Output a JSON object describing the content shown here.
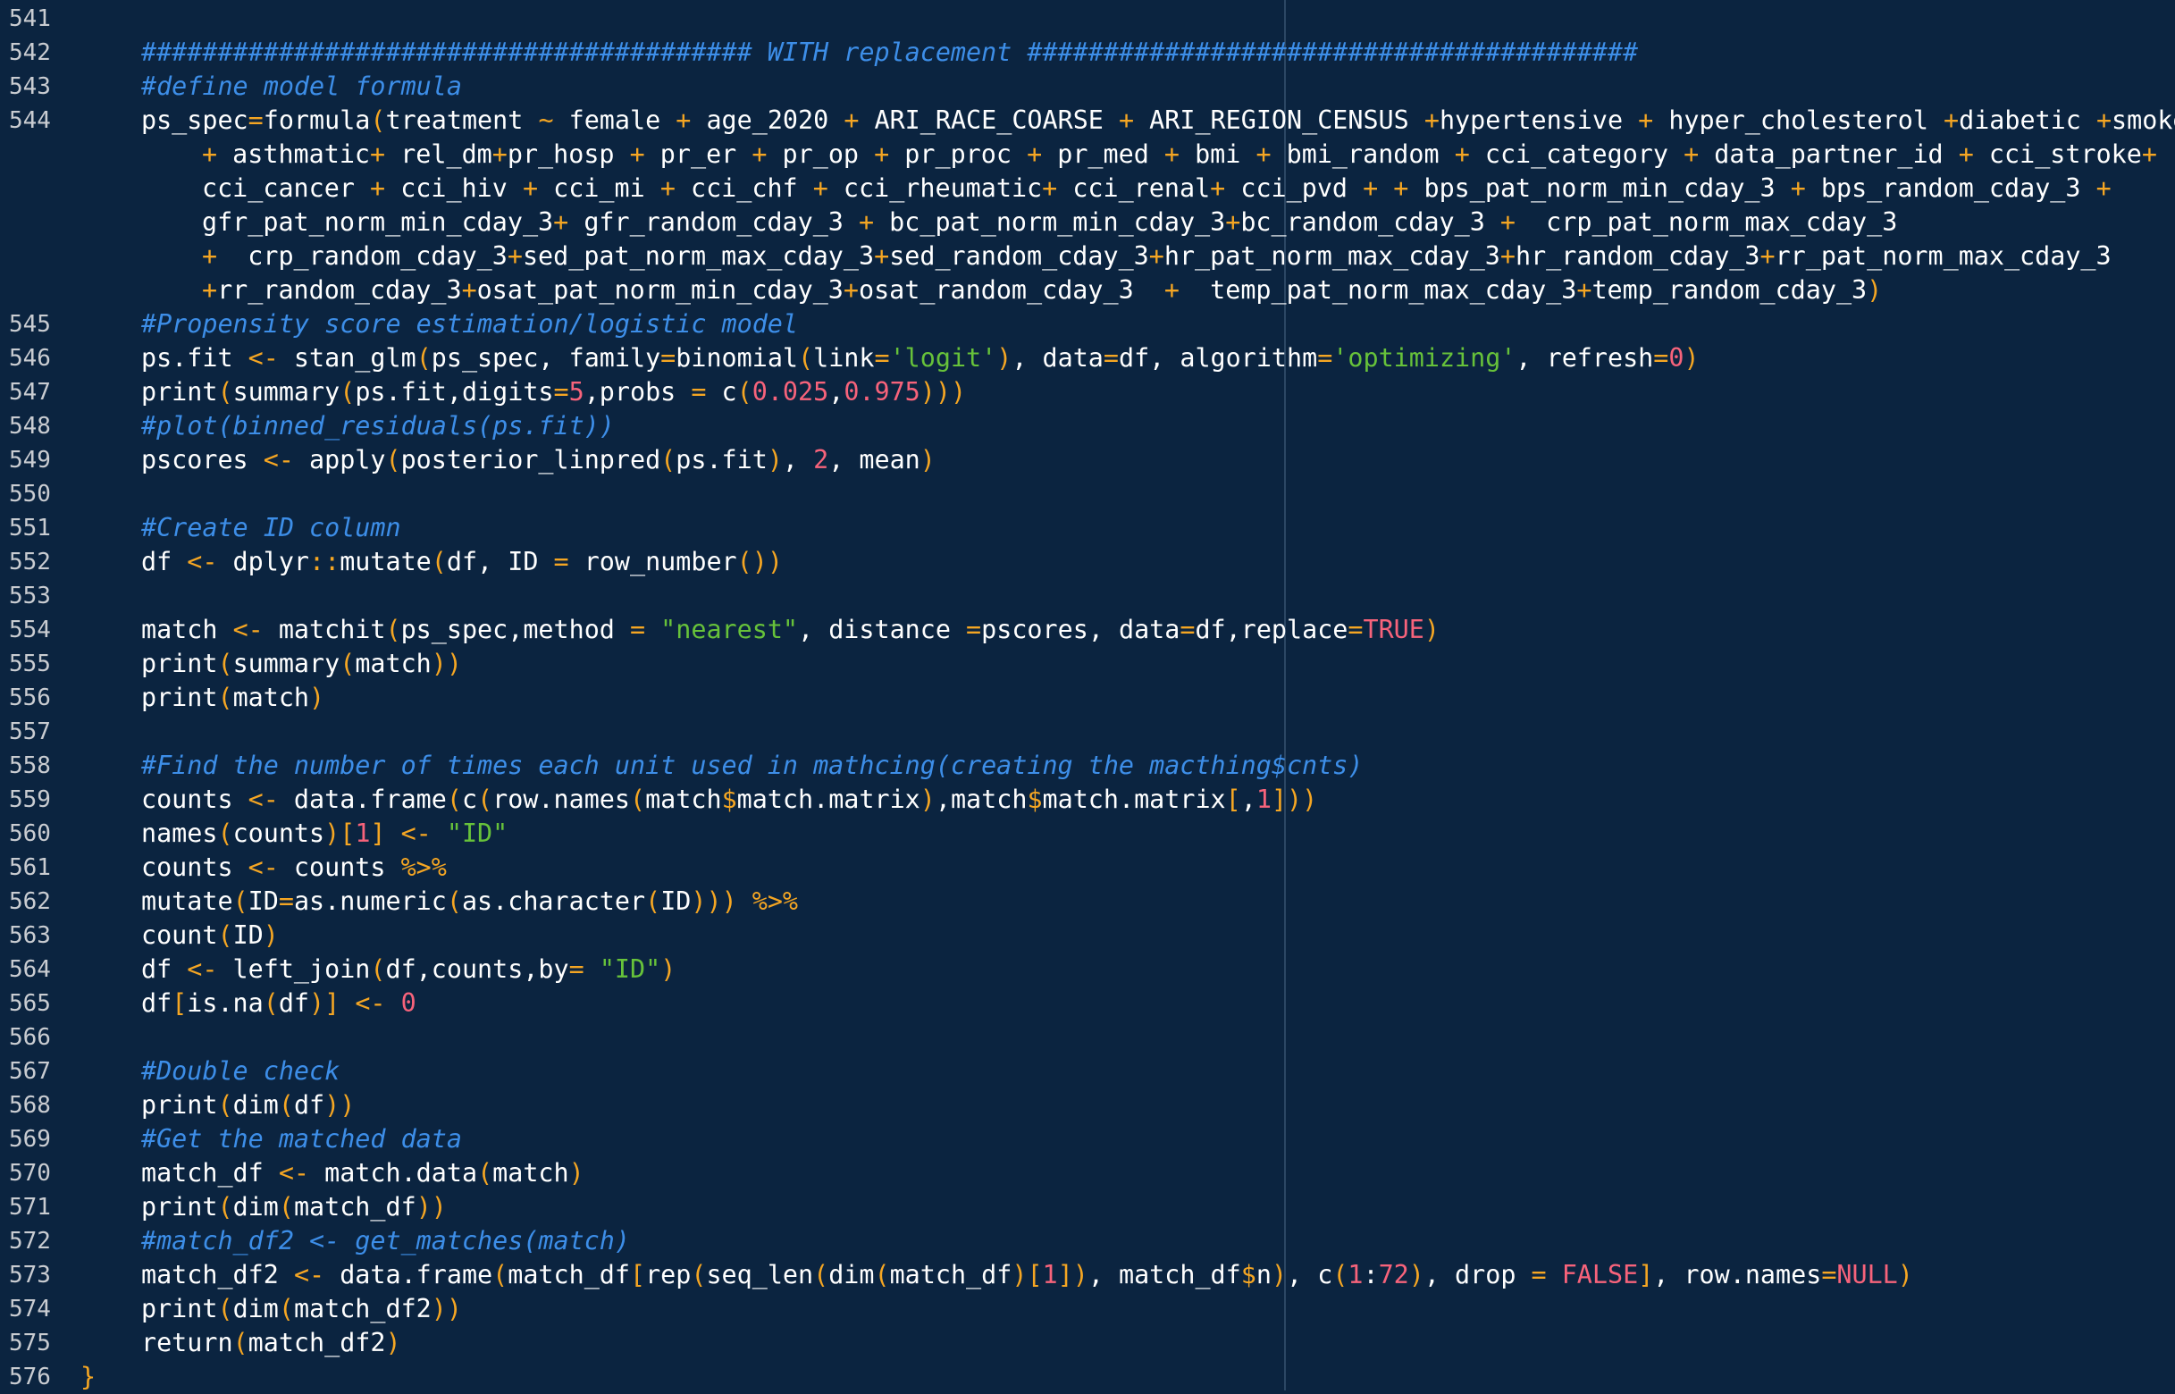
{
  "editor": {
    "lines": [
      {
        "n": "541",
        "t": ""
      },
      {
        "n": "542",
        "t": "######################################## WITH replacement ########################################"
      },
      {
        "n": "543",
        "t": "#define model formula"
      },
      {
        "n": "544",
        "t": "ps_spec=formula(treatment ~ female + age_2020 + ARI_RACE_COARSE + ARI_REGION_CENSUS +hypertensive + hyper_cholesterol +diabetic +smoker"
      },
      {
        "n": "",
        "t": "+ asthmatic+ rel_dm+pr_hosp + pr_er + pr_op + pr_proc + pr_med + bmi + bmi_random + cci_category + data_partner_id + cci_stroke+"
      },
      {
        "n": "",
        "t": "cci_cancer + cci_hiv + cci_mi + cci_chf + cci_rheumatic+ cci_renal+ cci_pvd + + bps_pat_norm_min_cday_3 + bps_random_cday_3 +"
      },
      {
        "n": "",
        "t": "gfr_pat_norm_min_cday_3+ gfr_random_cday_3 + bc_pat_norm_min_cday_3+bc_random_cday_3 +  crp_pat_norm_max_cday_3"
      },
      {
        "n": "",
        "t": "+  crp_random_cday_3+sed_pat_norm_max_cday_3+sed_random_cday_3+hr_pat_norm_max_cday_3+hr_random_cday_3+rr_pat_norm_max_cday_3"
      },
      {
        "n": "",
        "t": "+rr_random_cday_3+osat_pat_norm_min_cday_3+osat_random_cday_3  +  temp_pat_norm_max_cday_3+temp_random_cday_3)"
      },
      {
        "n": "545",
        "t": "#Propensity score estimation/logistic model"
      },
      {
        "n": "546",
        "t": "ps.fit <- stan_glm(ps_spec, family=binomial(link='logit'), data=df, algorithm='optimizing', refresh=0)"
      },
      {
        "n": "547",
        "t": "print(summary(ps.fit,digits=5,probs = c(0.025,0.975)))"
      },
      {
        "n": "548",
        "t": "#plot(binned_residuals(ps.fit))"
      },
      {
        "n": "549",
        "t": "pscores <- apply(posterior_linpred(ps.fit), 2, mean)"
      },
      {
        "n": "550",
        "t": ""
      },
      {
        "n": "551",
        "t": "#Create ID column"
      },
      {
        "n": "552",
        "t": "df <- dplyr::mutate(df, ID = row_number())"
      },
      {
        "n": "553",
        "t": ""
      },
      {
        "n": "554",
        "t": "match <- matchit(ps_spec,method = \"nearest\", distance =pscores, data=df,replace=TRUE)"
      },
      {
        "n": "555",
        "t": "print(summary(match))"
      },
      {
        "n": "556",
        "t": "print(match)"
      },
      {
        "n": "557",
        "t": ""
      },
      {
        "n": "558",
        "t": "#Find the number of times each unit used in mathcing(creating the macthing$cnts)"
      },
      {
        "n": "559",
        "t": "counts <- data.frame(c(row.names(match$match.matrix),match$match.matrix[,1]))"
      },
      {
        "n": "560",
        "t": "names(counts)[1] <- \"ID\""
      },
      {
        "n": "561",
        "t": "counts <- counts %>%"
      },
      {
        "n": "562",
        "t": "mutate(ID=as.numeric(as.character(ID))) %>%"
      },
      {
        "n": "563",
        "t": "count(ID)"
      },
      {
        "n": "564",
        "t": "df <- left_join(df,counts,by= \"ID\")"
      },
      {
        "n": "565",
        "t": "df[is.na(df)] <- 0"
      },
      {
        "n": "566",
        "t": ""
      },
      {
        "n": "567",
        "t": "#Double check"
      },
      {
        "n": "568",
        "t": "print(dim(df))"
      },
      {
        "n": "569",
        "t": "#Get the matched data"
      },
      {
        "n": "570",
        "t": "match_df <- match.data(match)"
      },
      {
        "n": "571",
        "t": "print(dim(match_df))"
      },
      {
        "n": "572",
        "t": "#match_df2 <- get_matches(match)"
      },
      {
        "n": "573",
        "t": "match_df2 <- data.frame(match_df[rep(seq_len(dim(match_df)[1]), match_df$n), c(1:72), drop = FALSE], row.names=NULL)"
      },
      {
        "n": "574",
        "t": "print(dim(match_df2))"
      },
      {
        "n": "575",
        "t": "return(match_df2)"
      },
      {
        "n": "576",
        "t": "}"
      }
    ]
  },
  "colors": {
    "background": "#0b2440",
    "text": "#ffffff",
    "comment": "#3d8ee8",
    "operator": "#f5a623",
    "number": "#f7637b",
    "string": "#67c23a",
    "line_number": "#c9ccd1",
    "print_margin": "#2c4764"
  }
}
